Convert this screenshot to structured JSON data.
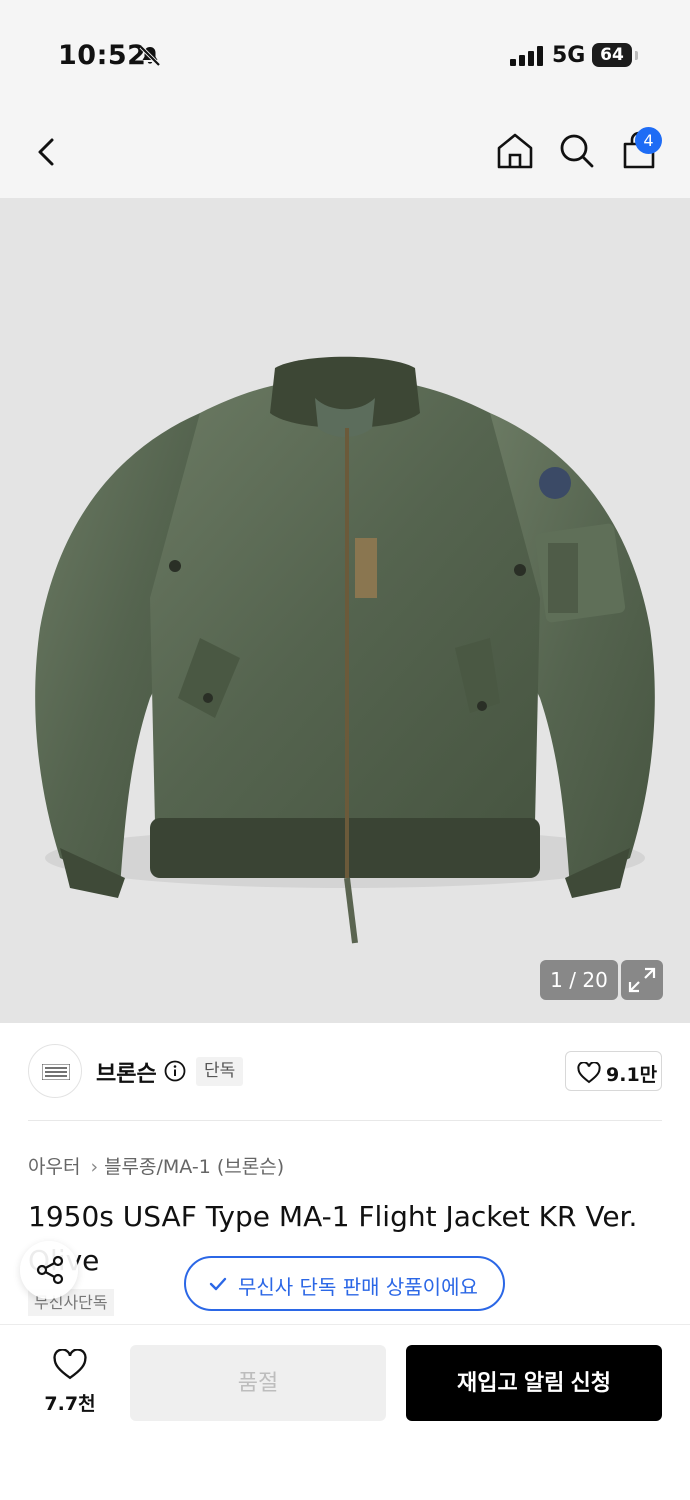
{
  "status_bar": {
    "time": "10:52",
    "network": "5G",
    "battery": "64"
  },
  "nav": {
    "cart_count": "4",
    "icons": [
      "back-icon",
      "home-icon",
      "search-icon",
      "shopping-bag-icon"
    ]
  },
  "gallery": {
    "counter": "1 / 20",
    "current_image": 1,
    "total_images": 20
  },
  "brand": {
    "name": "브론슨",
    "tag": "단독",
    "likes": "9.1만"
  },
  "breadcrumb": {
    "category": "아우터",
    "subcategory": "블루종/MA-1 (브론슨)"
  },
  "product": {
    "title_line1": "1950s USAF Type MA-1 Flight Jacket KR Ver.",
    "title_line2": "Olive",
    "exclusive_label": "무신사단독",
    "exclusive_banner": "무신사 단독 판매 상품이에요"
  },
  "bottom_bar": {
    "likes": "7.7천",
    "soldout_label": "품절",
    "restock_label": "재입고 알림 신청"
  },
  "colors": {
    "accent": "#2b67e6",
    "badge": "#1e6cf5",
    "cta": "#000000",
    "jacket": "#55644f"
  }
}
